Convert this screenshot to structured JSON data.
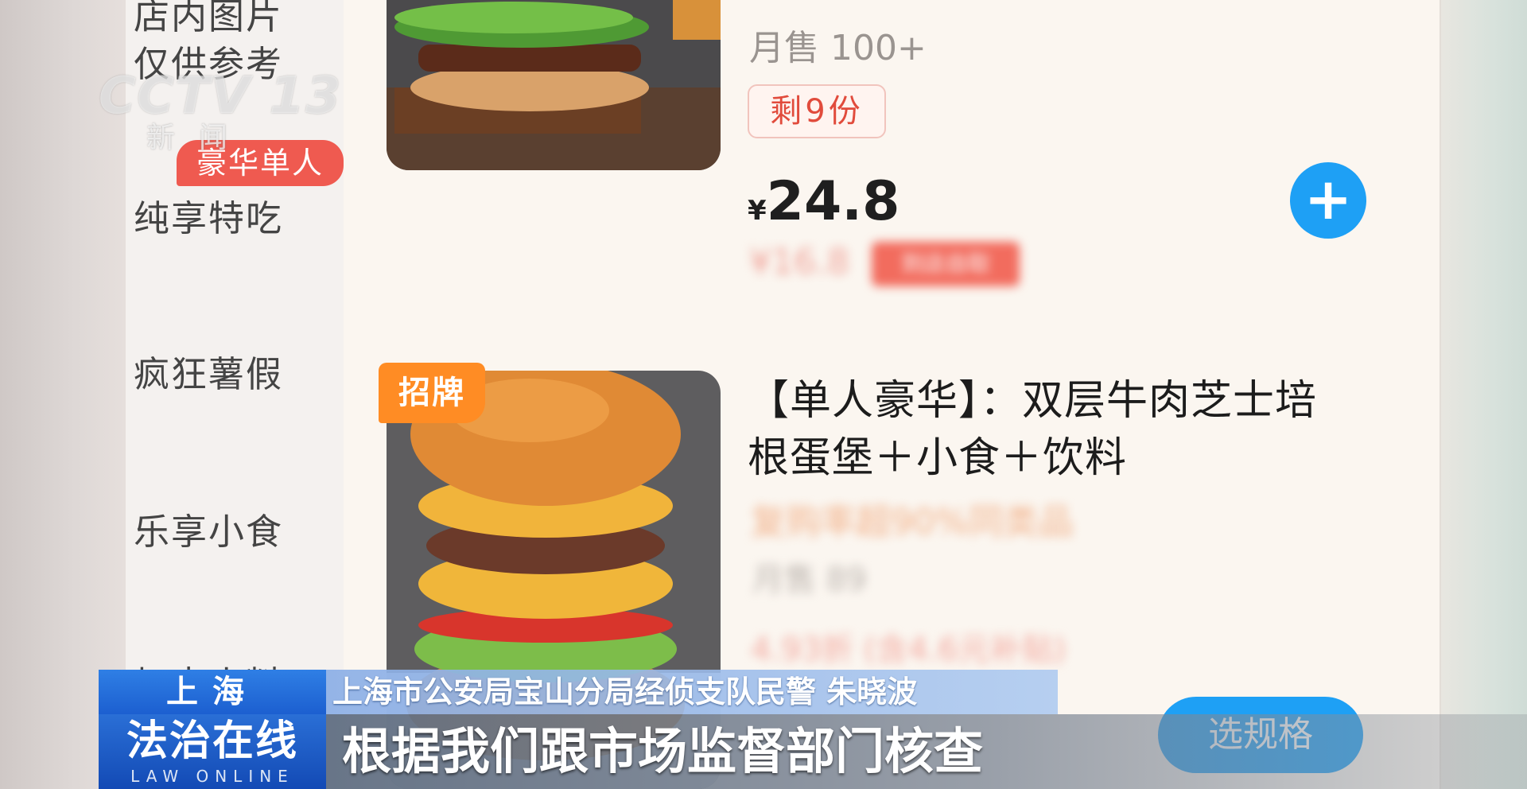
{
  "sidebar": {
    "categories": [
      {
        "label": "店内图片"
      },
      {
        "label": "仅供参考"
      },
      {
        "label": "纯享特吃"
      },
      {
        "label": "疯狂薯假"
      },
      {
        "label": "乐享小食"
      },
      {
        "label": "加点小料"
      }
    ],
    "hot_tag": "豪华单人"
  },
  "item1": {
    "monthly_sales": "月售 100+",
    "stock": "剩9份",
    "currency": "¥",
    "price": "24.8",
    "old_price": "¥16.8",
    "old_price_tag": "到店自取"
  },
  "item2": {
    "badge": "招牌",
    "title_line1": "【单人豪华】：双层牛肉芝士培",
    "title_line2": "根蛋堡＋小食＋饮料",
    "repurchase": "复购率超90%同类品",
    "monthly_sales": "月售 89",
    "discount": "4.93折 (含4.6元补贴)",
    "spec_button": "选规格"
  },
  "overlay": {
    "logo": "CCTV 13",
    "logo_sub": "新闻",
    "location": "上海",
    "speaker": "上海市公安局宝山分局经侦支队民警 朱晓波",
    "program_cn": "法治在线",
    "program_en": "LAW ONLINE",
    "subtitle": "根据我们跟市场监督部门核查"
  },
  "colors": {
    "accent_blue": "#1ea0f5",
    "tag_red": "#ef5a50",
    "badge_orange": "#ff8c24"
  }
}
